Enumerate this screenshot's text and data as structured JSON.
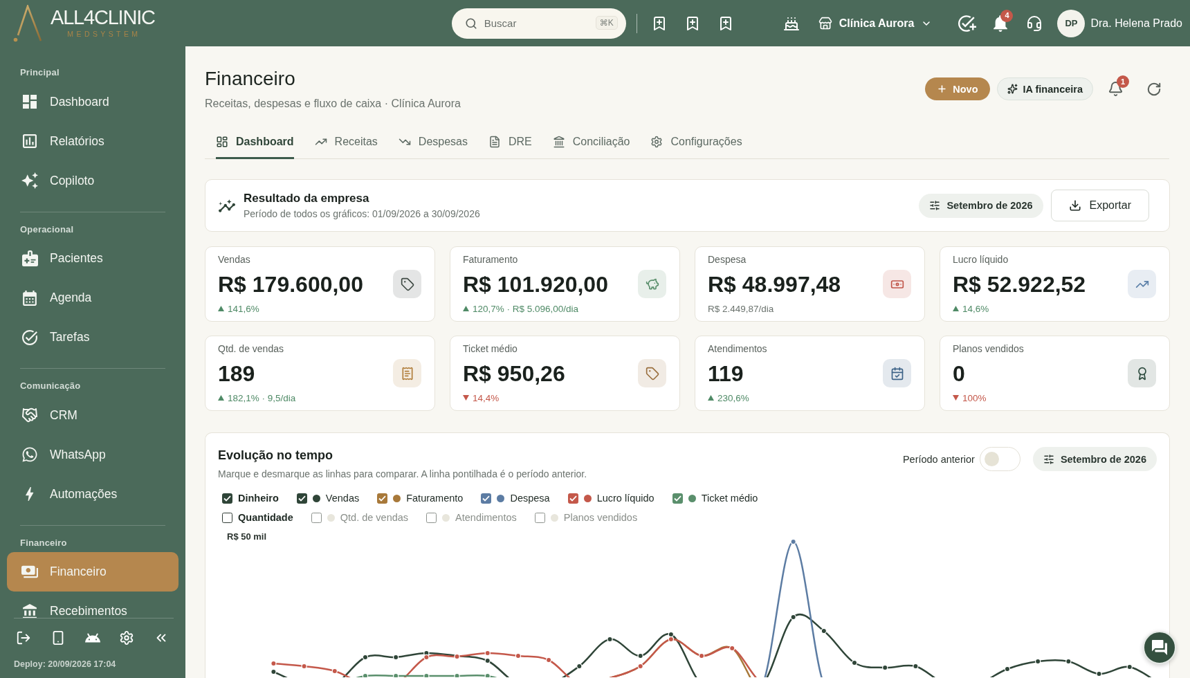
{
  "topbar": {
    "logo": {
      "wordmark": "ALL4CLINIC",
      "tagline": "MEDSYSTEM"
    },
    "search": {
      "placeholder": "Buscar",
      "shortcut": "⌘K"
    },
    "clinic": "Clínica Aurora",
    "notification_count": "4",
    "user": {
      "initials": "DP",
      "name": "Dra. Helena Prado"
    }
  },
  "sidebar": {
    "sections": [
      {
        "title": "Principal",
        "items": [
          {
            "label": "Dashboard",
            "selected": false
          },
          {
            "label": "Relatórios",
            "selected": false
          },
          {
            "label": "Copiloto",
            "selected": false
          }
        ]
      },
      {
        "title": "Operacional",
        "items": [
          {
            "label": "Pacientes",
            "selected": false
          },
          {
            "label": "Agenda",
            "selected": false
          },
          {
            "label": "Tarefas",
            "selected": false
          }
        ]
      },
      {
        "title": "Comunicação",
        "items": [
          {
            "label": "CRM",
            "selected": false
          },
          {
            "label": "WhatsApp",
            "selected": false
          },
          {
            "label": "Automações",
            "selected": false
          }
        ]
      },
      {
        "title": "Financeiro",
        "items": [
          {
            "label": "Financeiro",
            "selected": true
          },
          {
            "label": "Recebimentos",
            "selected": false
          }
        ]
      }
    ],
    "deploy": "Deploy: 20/09/2026 17:04"
  },
  "page": {
    "title": "Financeiro",
    "subtitle": "Receitas, despesas e fluxo de caixa · Clínica Aurora",
    "new_button": "Novo",
    "ai_button": "IA financeira",
    "alert_count": "1"
  },
  "tabs": [
    {
      "label": "Dashboard",
      "selected": true
    },
    {
      "label": "Receitas",
      "selected": false
    },
    {
      "label": "Despesas",
      "selected": false
    },
    {
      "label": "DRE",
      "selected": false
    },
    {
      "label": "Conciliação",
      "selected": false
    },
    {
      "label": "Configurações",
      "selected": false
    }
  ],
  "summary": {
    "title": "Resultado da empresa",
    "subtitle": "Período de todos os gráficos: 01/09/2026 a 30/09/2026",
    "period": "Setembro de 2026",
    "export_button": "Exportar"
  },
  "kpis": [
    {
      "label": "Vendas",
      "value": "R$ 179.600,00",
      "kind": "up",
      "detail": "141,6%",
      "color": "#3f4a44"
    },
    {
      "label": "Faturamento",
      "value": "R$ 101.920,00",
      "kind": "up",
      "detail": "120,7% · R$ 5.096,00/dia",
      "color": "#5a8f6c"
    },
    {
      "label": "Despesa",
      "value": "R$ 48.997,48",
      "kind": "plain",
      "detail": "R$ 2.449,87/dia",
      "color": "#c0564a"
    },
    {
      "label": "Lucro líquido",
      "value": "R$ 52.922,52",
      "kind": "up",
      "detail": "14,6%",
      "color": "#5a7fa8"
    },
    {
      "label": "Qtd. de vendas",
      "value": "189",
      "kind": "up",
      "detail": "182,1% · 9,5/dia",
      "color": "#b07d3a"
    },
    {
      "label": "Ticket médio",
      "value": "R$ 950,26",
      "kind": "down",
      "detail": "14,4%",
      "color": "#9a6f3e"
    },
    {
      "label": "Atendimentos",
      "value": "119",
      "kind": "up",
      "detail": "230,6%",
      "color": "#3e6488"
    },
    {
      "label": "Planos vendidos",
      "value": "0",
      "kind": "down",
      "detail": "100%",
      "color": "#2f4d40"
    }
  ],
  "chart": {
    "title": "Evolução no tempo",
    "subtitle": "Marque e desmarque as linhas para comparar. A linha pontilhada é o período anterior.",
    "compare": {
      "label": "Período anterior",
      "on": false
    },
    "period": "Setembro de 2026",
    "legend_groups": [
      {
        "label": "Dinheiro",
        "checked": true,
        "series": [
          {
            "label": "Vendas",
            "checked": true,
            "color": "#2f4538"
          },
          {
            "label": "Faturamento",
            "checked": true,
            "color": "#a8793a"
          },
          {
            "label": "Despesa",
            "checked": true,
            "color": "#5c7ca3"
          },
          {
            "label": "Lucro líquido",
            "checked": true,
            "color": "#c4584a"
          },
          {
            "label": "Ticket médio",
            "checked": true,
            "color": "#5a8f6c"
          }
        ]
      },
      {
        "label": "Quantidade",
        "checked": false,
        "series": [
          {
            "label": "Qtd. de vendas",
            "checked": false,
            "color": "#e8e6dc"
          },
          {
            "label": "Atendimentos",
            "checked": false,
            "color": "#e8e6dc"
          },
          {
            "label": "Planos vendidos",
            "checked": false,
            "color": "#e8e6dc"
          }
        ]
      }
    ],
    "axis_label": "R$ 50 mil"
  }
}
